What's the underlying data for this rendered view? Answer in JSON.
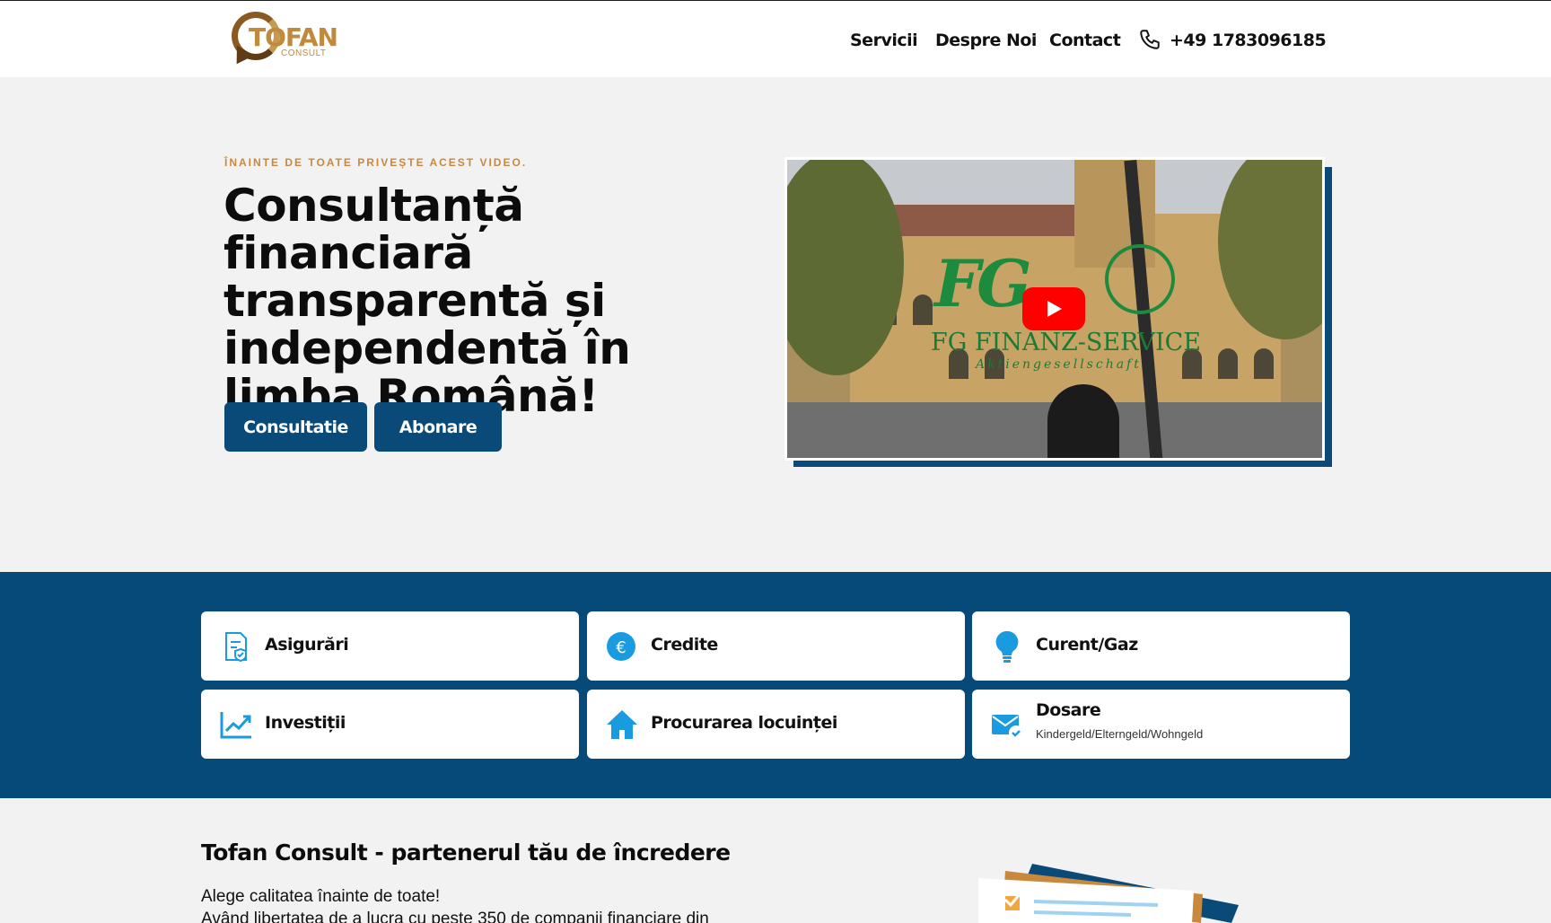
{
  "header": {
    "logo_text": "TOFAN",
    "logo_sub": "CONSULT",
    "nav": [
      "Servicii",
      "Despre Noi",
      "Contact"
    ],
    "phone": "+49 1783096185"
  },
  "hero": {
    "kicker": "ÎNAINTE DE TOATE PRIVEȘTE ACEST VIDEO.",
    "title": "Consultanță financiară transparentă și independentă în limba Română!",
    "buttons": {
      "consultatie": "Consultatie",
      "abonare": "Abonare"
    },
    "video": {
      "brand": "FG FINANZ-SERVICE",
      "brand_sub": "Aktiengesellschaft"
    }
  },
  "services": [
    {
      "label": "Asigurări",
      "icon": "insurance-document-icon"
    },
    {
      "label": "Credite",
      "icon": "euro-coin-icon"
    },
    {
      "label": "Curent/Gaz",
      "icon": "lightbulb-icon"
    },
    {
      "label": "Investiții",
      "icon": "chart-trend-icon"
    },
    {
      "label": "Procurarea locuinței",
      "icon": "house-icon"
    },
    {
      "label": "Dosare",
      "sub": "Kindergeld/Elterngeld/Wohngeld",
      "icon": "mail-check-icon"
    }
  ],
  "about": {
    "title": "Tofan Consult - partenerul tău de încredere",
    "lines": [
      "Alege calitatea înainte de toate!",
      "Având libertatea de a lucra cu peste 350 de companii financiare din"
    ]
  },
  "colors": {
    "primary": "#054a79",
    "accent": "#c8893e",
    "icon_blue": "#1a9be0"
  }
}
